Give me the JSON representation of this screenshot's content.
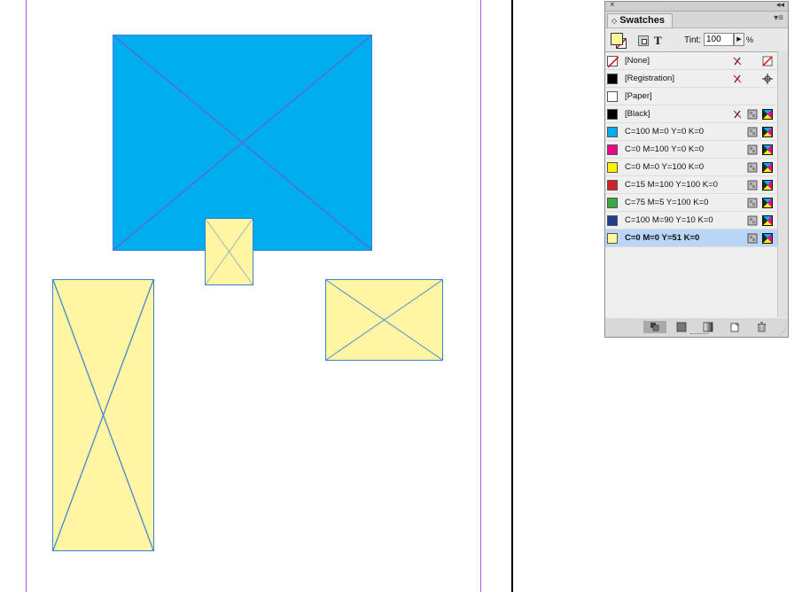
{
  "document": {
    "frame_colors": {
      "blue": "#00aeef",
      "yellow": "#fff5a3",
      "frame_edge": "#3a7fd8",
      "margin_guide": "#b05ad6"
    }
  },
  "panel": {
    "title": "Swatches",
    "close_glyph": "×",
    "collapse_glyph": "◂◂",
    "menu_glyph": "▾≡",
    "tint_label": "Tint:",
    "tint_value": "100",
    "tint_unit": "%",
    "type_glyph": "T",
    "swatches": [
      {
        "name": "[None]",
        "color": "none",
        "lock": true,
        "mode": "none"
      },
      {
        "name": "[Registration]",
        "color": "#000000",
        "lock": true,
        "mode": "registration"
      },
      {
        "name": "[Paper]",
        "color": "#ffffff",
        "lock": false,
        "mode": ""
      },
      {
        "name": "[Black]",
        "color": "#000000",
        "lock": true,
        "mode": "cmyk",
        "process": true
      },
      {
        "name": "C=100 M=0 Y=0 K=0",
        "color": "#00aeef",
        "mode": "cmyk",
        "process": true
      },
      {
        "name": "C=0 M=100 Y=0 K=0",
        "color": "#ec008c",
        "mode": "cmyk",
        "process": true
      },
      {
        "name": "C=0 M=0 Y=100 K=0",
        "color": "#fff200",
        "mode": "cmyk",
        "process": true
      },
      {
        "name": "C=15 M=100 Y=100 K=0",
        "color": "#d12229",
        "mode": "cmyk",
        "process": true
      },
      {
        "name": "C=75 M=5 Y=100 K=0",
        "color": "#3aa845",
        "mode": "cmyk",
        "process": true
      },
      {
        "name": "C=100 M=90 Y=10 K=0",
        "color": "#243f8f",
        "mode": "cmyk",
        "process": true
      },
      {
        "name": "C=0 M=0 Y=51 K=0",
        "color": "#fff59d",
        "mode": "cmyk",
        "process": true,
        "selected": true
      }
    ],
    "bottom_buttons": [
      "show-all-swatches-icon",
      "show-color-swatches-icon",
      "show-gradient-swatches-icon",
      "new-swatch-icon",
      "delete-swatch-icon"
    ]
  }
}
